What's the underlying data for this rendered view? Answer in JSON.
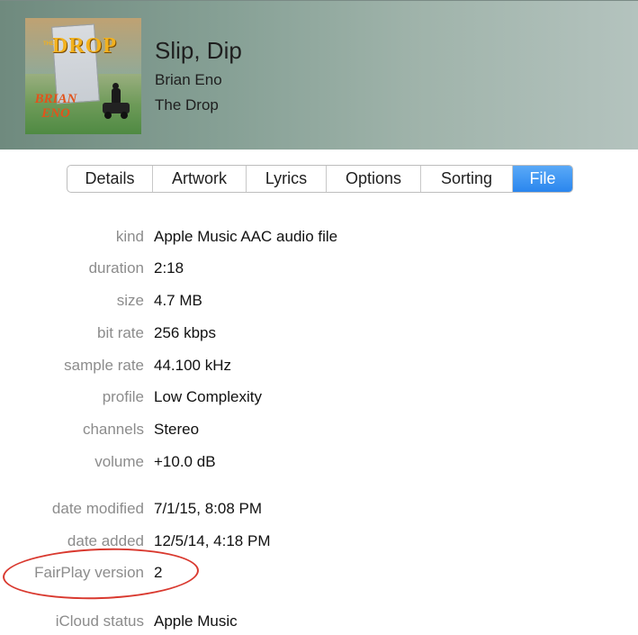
{
  "track": {
    "title": "Slip, Dip",
    "artist": "Brian Eno",
    "album": "The Drop"
  },
  "artwork": {
    "album_text": "DROP",
    "the_text": "THE",
    "artist_text_line1": "BRIAN",
    "artist_text_line2": "ENO"
  },
  "tabs": [
    {
      "label": "Details"
    },
    {
      "label": "Artwork"
    },
    {
      "label": "Lyrics"
    },
    {
      "label": "Options"
    },
    {
      "label": "Sorting"
    },
    {
      "label": "File",
      "active": true
    }
  ],
  "file_info": [
    {
      "label": "kind",
      "value": "Apple Music AAC audio file"
    },
    {
      "label": "duration",
      "value": "2:18"
    },
    {
      "label": "size",
      "value": "4.7 MB"
    },
    {
      "label": "bit rate",
      "value": "256 kbps"
    },
    {
      "label": "sample rate",
      "value": "44.100 kHz"
    },
    {
      "label": "profile",
      "value": "Low Complexity"
    },
    {
      "label": "channels",
      "value": "Stereo"
    },
    {
      "label": "volume",
      "value": "+10.0 dB"
    },
    {
      "label": "date modified",
      "value": "7/1/15, 8:08 PM"
    },
    {
      "label": "date added",
      "value": "12/5/14, 4:18 PM"
    },
    {
      "label": "FairPlay version",
      "value": "2"
    },
    {
      "label": "iCloud status",
      "value": "Apple Music"
    }
  ],
  "colors": {
    "active_tab": "#2a86ee",
    "annotation": "#d9392f",
    "label_gray": "#8c8c8c"
  }
}
